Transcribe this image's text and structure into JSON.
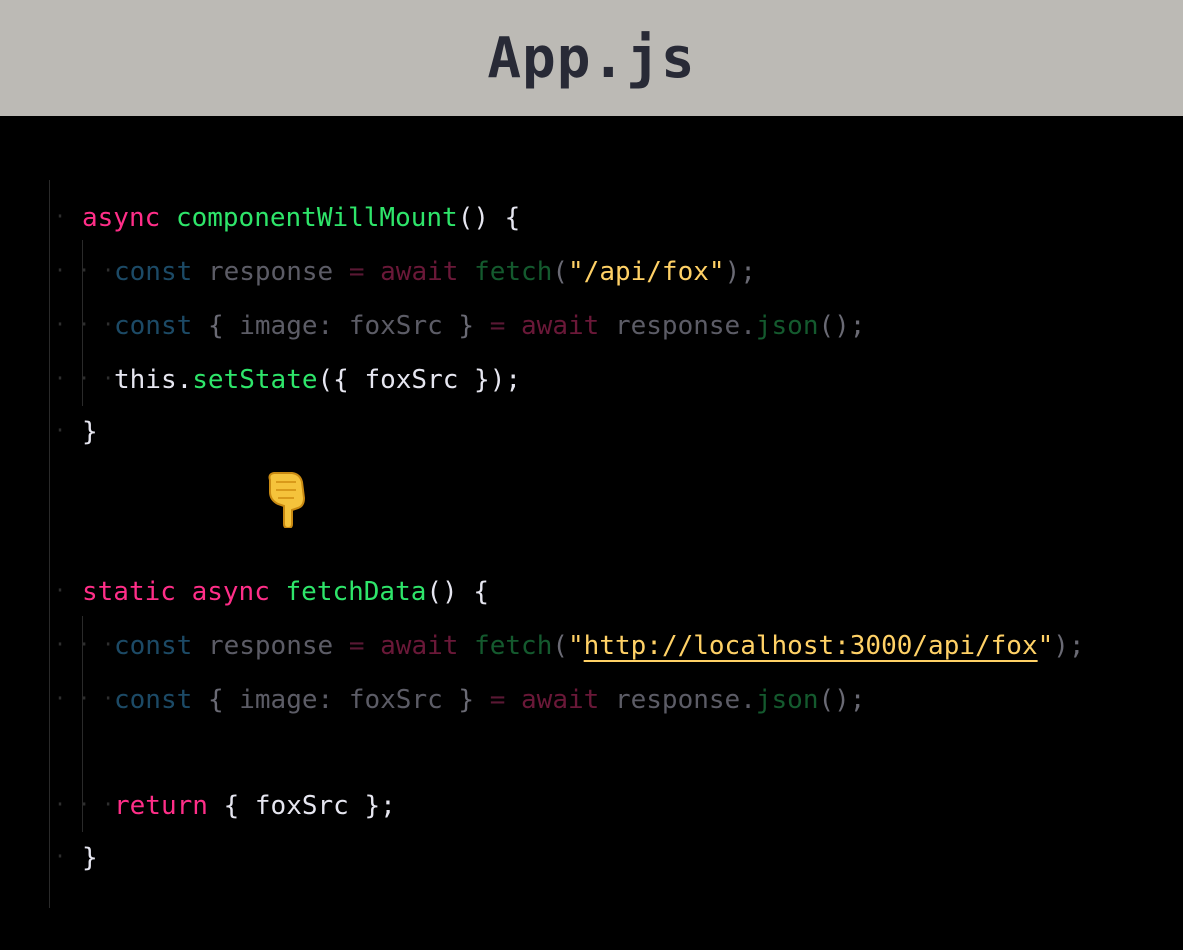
{
  "window": {
    "title": "App.js"
  },
  "colors": {
    "title_bar": "#bcbab5",
    "editor_bg": "#000000",
    "keyword": "#ff2e88",
    "function": "#2ee56a",
    "string": "#ffd166",
    "dim_keyword": "#1c4a66"
  },
  "code": {
    "l1": {
      "kw": "async",
      "fn": "componentWillMount",
      "rest": "() {"
    },
    "l2": {
      "kw": "const",
      "id": "response",
      "op": "=",
      "aw": "await",
      "fn": "fetch",
      "open": "(",
      "str": "\"/api/fox\"",
      "close": ");"
    },
    "l3": {
      "kw": "const",
      "brace_open": "{",
      "id": "image:",
      "id2": "foxSrc",
      "brace_close": "}",
      "op": "=",
      "aw": "await",
      "obj": "response.",
      "fn": "json",
      "close": "();"
    },
    "l4": {
      "this": "this.",
      "fn": "setState",
      "rest": "({ foxSrc });"
    },
    "l5": {
      "text": "}"
    },
    "l6": {
      "kw1": "static",
      "kw2": "async",
      "fn": "fetchData",
      "rest": "() {"
    },
    "l7": {
      "kw": "const",
      "id": "response",
      "op": "=",
      "aw": "await",
      "fn": "fetch",
      "open": "(",
      "q1": "\"",
      "url": "http://localhost:3000/api/fox",
      "q2": "\"",
      "close": ");"
    },
    "l8": {
      "kw": "const",
      "brace_open": "{",
      "id": "image:",
      "id2": "foxSrc",
      "brace_close": "}",
      "op": "=",
      "aw": "await",
      "obj": "response.",
      "fn": "json",
      "close": "();"
    },
    "l9": {
      "kw": "return",
      "rest": "{ foxSrc };"
    },
    "l10": {
      "text": "}"
    }
  },
  "icons": {
    "pointer": "pointing-down-hand-icon"
  }
}
